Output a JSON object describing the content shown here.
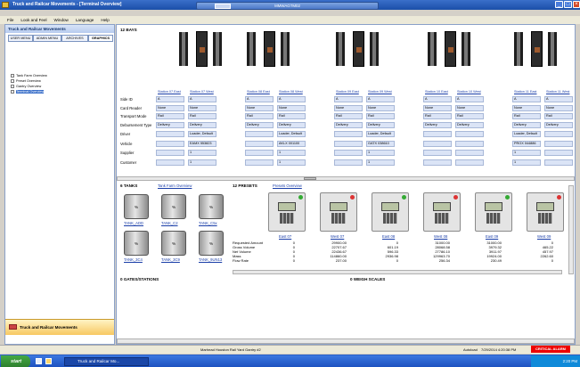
{
  "window": {
    "title": "Truck and Railcar Movements - [Terminal Overview]"
  },
  "remote": {
    "title": "MMWAGTM02"
  },
  "menu": [
    "File",
    "Look and Feel",
    "Window",
    "Language",
    "Help"
  ],
  "left_panel": {
    "title": "Truck and Railcar Movements",
    "tabs": [
      "USER MENU",
      "ADMIN MENU",
      "ARCHIVES",
      "GRAPHICS"
    ],
    "tree": [
      "Tank Farm Overview",
      "Preset Overview",
      "Gantry Overview",
      "Terminal Overview"
    ],
    "bottom_label": "Truck and Railcar Movements"
  },
  "bays": {
    "title": "12 BAYS",
    "stations": [
      "Station 07 East",
      "Station 07 West",
      "Station 08 East",
      "Station 08 West",
      "Station 09 East",
      "Station 09 West",
      "Station 10 East",
      "Station 10 West",
      "Station 11 East",
      "Station 11 West"
    ],
    "row_labels": [
      "Side ID",
      "Card Reader",
      "Transport Mode",
      "Debursement Type",
      "Driver",
      "Vehicle",
      "Supplier",
      "Customer"
    ],
    "columns": [
      [
        "A",
        "None",
        "Rail",
        "Delivery",
        "",
        "",
        "",
        ""
      ],
      [
        "A",
        "None",
        "Rail",
        "Delivery",
        "Loader, Default",
        "EAMX 553823",
        "1",
        "1"
      ],
      [
        "A",
        "None",
        "Rail",
        "Delivery",
        "",
        "",
        "",
        ""
      ],
      [
        "A",
        "None",
        "Rail",
        "Delivery",
        "Loader, Default",
        "AKLX 001100",
        "1",
        "1"
      ],
      [
        "A",
        "None",
        "Rail",
        "Delivery",
        "",
        "",
        "",
        ""
      ],
      [
        "A",
        "None",
        "Rail",
        "Delivery",
        "Loader, Default",
        "GATX 038610",
        "1",
        "1"
      ],
      [
        "A",
        "None",
        "Rail",
        "Delivery",
        "",
        "",
        "",
        ""
      ],
      [
        "A",
        "None",
        "Rail",
        "Delivery",
        "",
        "",
        "",
        ""
      ],
      [
        "A",
        "None",
        "Rail",
        "Delivery",
        "Loader, Default",
        "PROX 044886",
        "1",
        "1"
      ],
      [
        "A",
        "None",
        "Rail",
        "Delivery",
        "",
        "",
        "",
        ""
      ]
    ]
  },
  "tanks": {
    "title": "6 TANKS",
    "link": "Tank Farm Overview",
    "names": [
      "TANK_ADD",
      "TANK_C2",
      "TANK_C5x",
      "TANK_3C4",
      "TANK_3C9",
      "TANK_9UN13"
    ]
  },
  "presets": {
    "title": "12 PRESETS",
    "link": "Presets Overview",
    "names": [
      "East 07",
      "West 07",
      "East 08",
      "West 08",
      "East 09",
      "West 09"
    ],
    "row_labels": [
      "Requested Amount",
      "Gross Volume",
      "Net Volume",
      "Mass",
      "Flow Rate"
    ],
    "values": [
      [
        "0",
        "0",
        "0",
        "0",
        "0"
      ],
      [
        "29900.00",
        "22707.67",
        "22436.67",
        "114860.00",
        "237.00"
      ],
      [
        "0",
        "601.19",
        "596.33",
        "2936.98",
        "0"
      ],
      [
        "31000.00",
        "28068.58",
        "27786.10",
        "129963.70",
        "256.34"
      ],
      [
        "31000.00",
        "3979.32",
        "3911.97",
        "19924.00",
        "230.49"
      ],
      [
        "0",
        "465.22",
        "457.97",
        "2262.60",
        "0"
      ]
    ]
  },
  "gates": {
    "title": "0 GATES/STATIONS"
  },
  "scales": {
    "title": "0 WEIGH SCALES"
  },
  "status": {
    "center": "Marhead Houston Rail Yard Gantry #2",
    "autoload": "Autoload",
    "datetime": "7/29/2014 4:20:38 PM",
    "alarm": "CRITICAL ALARM"
  },
  "taskbar": {
    "start": "start",
    "task": "Truck and Railcar Mo...",
    "clock": "2:20 PM"
  }
}
